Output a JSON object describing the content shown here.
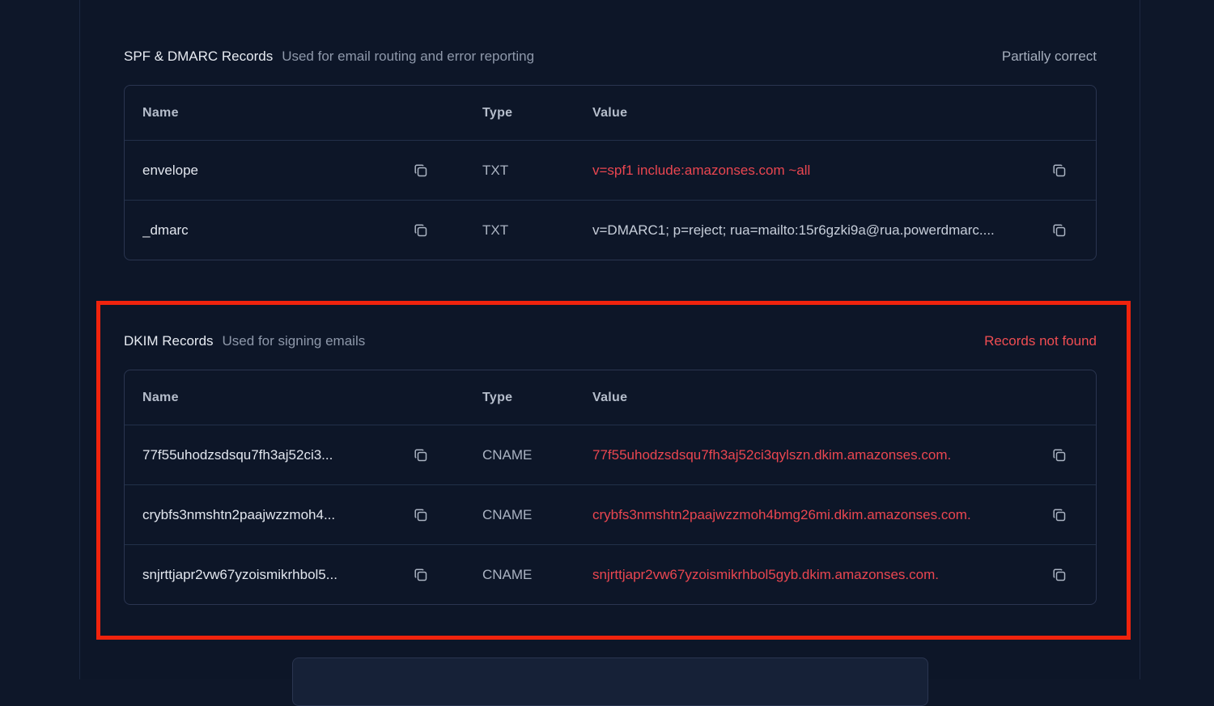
{
  "spf_section": {
    "title": "SPF & DMARC Records",
    "subtitle": "Used for email routing and error reporting",
    "status": "Partially correct",
    "columns": {
      "name": "Name",
      "type": "Type",
      "value": "Value"
    },
    "rows": [
      {
        "name": "envelope",
        "type": "TXT",
        "value": "v=spf1 include:amazonses.com ~all",
        "value_state": "error"
      },
      {
        "name": "_dmarc",
        "type": "TXT",
        "value": "v=DMARC1; p=reject; rua=mailto:15r6gzki9a@rua.powerdmarc....",
        "value_state": "ok"
      }
    ]
  },
  "dkim_section": {
    "title": "DKIM Records",
    "subtitle": "Used for signing emails",
    "status": "Records not found",
    "columns": {
      "name": "Name",
      "type": "Type",
      "value": "Value"
    },
    "rows": [
      {
        "name": "77f55uhodzsdsqu7fh3aj52ci3...",
        "type": "CNAME",
        "value": "77f55uhodzsdsqu7fh3aj52ci3qylszn.dkim.amazonses.com.",
        "value_state": "error"
      },
      {
        "name": "crybfs3nmshtn2paajwzzmoh4...",
        "type": "CNAME",
        "value": "crybfs3nmshtn2paajwzzmoh4bmg26mi.dkim.amazonses.com.",
        "value_state": "error"
      },
      {
        "name": "snjrttjapr2vw67yzoismikrhbol5...",
        "type": "CNAME",
        "value": "snjrttjapr2vw67yzoismikrhbol5gyb.dkim.amazonses.com.",
        "value_state": "error"
      }
    ]
  },
  "icons": {
    "copy": "copy-icon"
  },
  "colors": {
    "background": "#0d1628",
    "error_text": "#ea4650",
    "highlight_border": "#f0230d",
    "table_border": "#2a3550"
  }
}
